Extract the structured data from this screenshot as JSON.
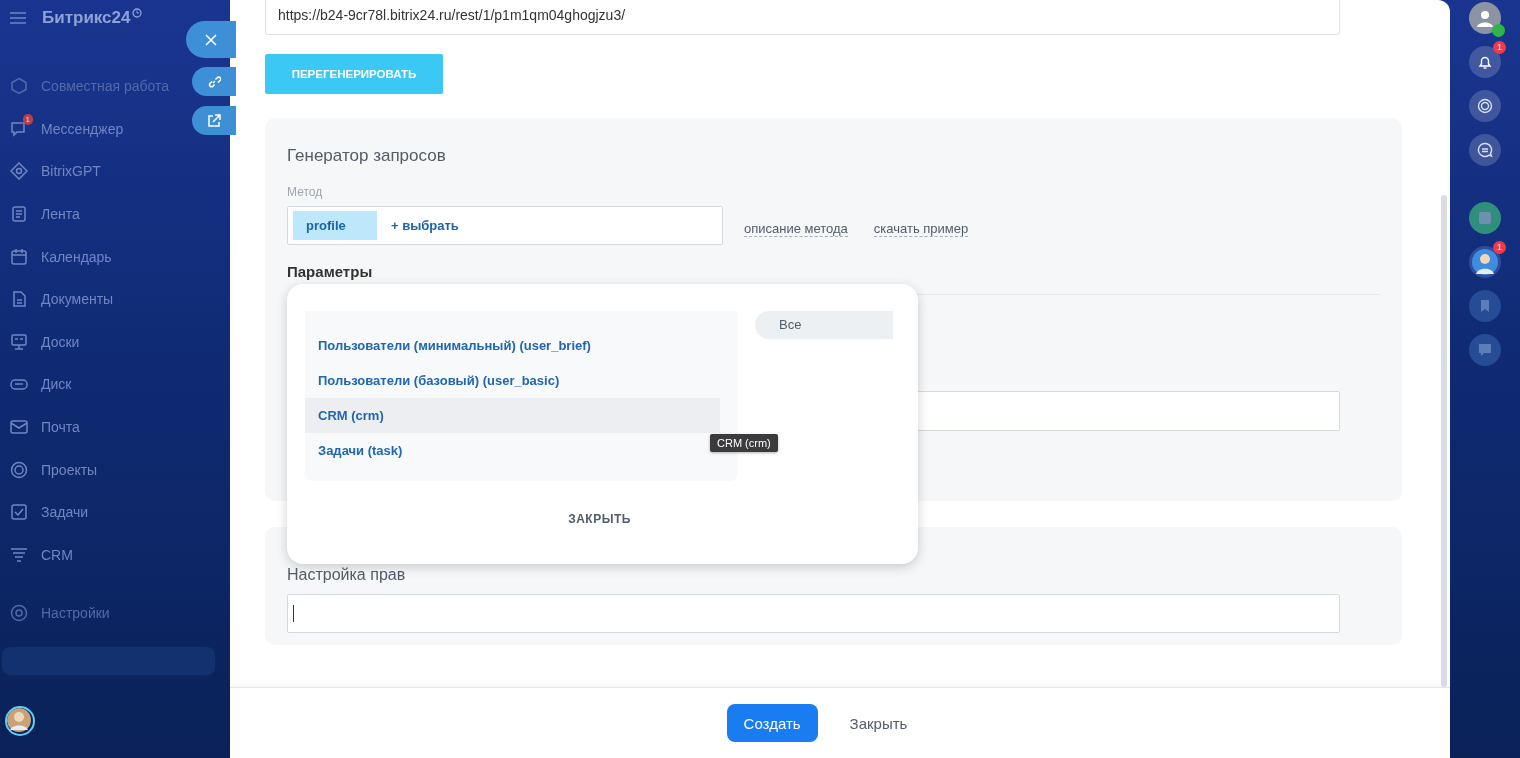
{
  "sidebar": {
    "logo": "Битрикс24",
    "items": [
      {
        "label": "Совместная работа",
        "dimmed": true
      },
      {
        "label": "Мессенджер",
        "dimmed": false,
        "badge": "1"
      },
      {
        "label": "BitrixGPT",
        "dimmed": false
      },
      {
        "label": "Лента",
        "dimmed": false
      },
      {
        "label": "Календарь",
        "dimmed": false
      },
      {
        "label": "Документы",
        "dimmed": false
      },
      {
        "label": "Доски",
        "dimmed": false
      },
      {
        "label": "Диск",
        "dimmed": false
      },
      {
        "label": "Почта",
        "dimmed": false
      },
      {
        "label": "Проекты",
        "dimmed": false
      },
      {
        "label": "Задачи",
        "dimmed": false
      },
      {
        "label": "CRM",
        "dimmed": false
      }
    ],
    "footer_items": [
      {
        "label": "Настройки",
        "dimmed": true
      }
    ]
  },
  "url_field": {
    "value": "https://b24-9cr78l.bitrix24.ru/rest/1/p1m1qm04ghogjzu3/"
  },
  "regenerate_button": "ПЕРЕГЕНЕРИРОВАТЬ",
  "request_generator": {
    "title": "Генератор запросов",
    "method_label": "Метод",
    "method_tag": "profile",
    "pick_link": "+ выбрать",
    "links": [
      "описание метода",
      "скачать пример"
    ],
    "params_title": "Параметры"
  },
  "rights": {
    "title": "Настройка прав"
  },
  "footer": {
    "buttons": [
      {
        "label": "Создать",
        "kind": "primary"
      },
      {
        "label": "Закрыть",
        "kind": "link"
      }
    ]
  },
  "scope_popup": {
    "items": [
      {
        "label": "Пользователи (минимальный) (user_brief)",
        "selected": false
      },
      {
        "label": "Пользователи (базовый) (user_basic)",
        "selected": false
      },
      {
        "label": "CRM (crm)",
        "selected": true
      },
      {
        "label": "Задачи (task)",
        "selected": false
      }
    ],
    "filter": "Все",
    "close_button": "ЗАКРЫТЬ",
    "tooltip": "CRM (crm)"
  },
  "right_bar": {
    "notification_badge": "1",
    "chat_badge": "1"
  }
}
